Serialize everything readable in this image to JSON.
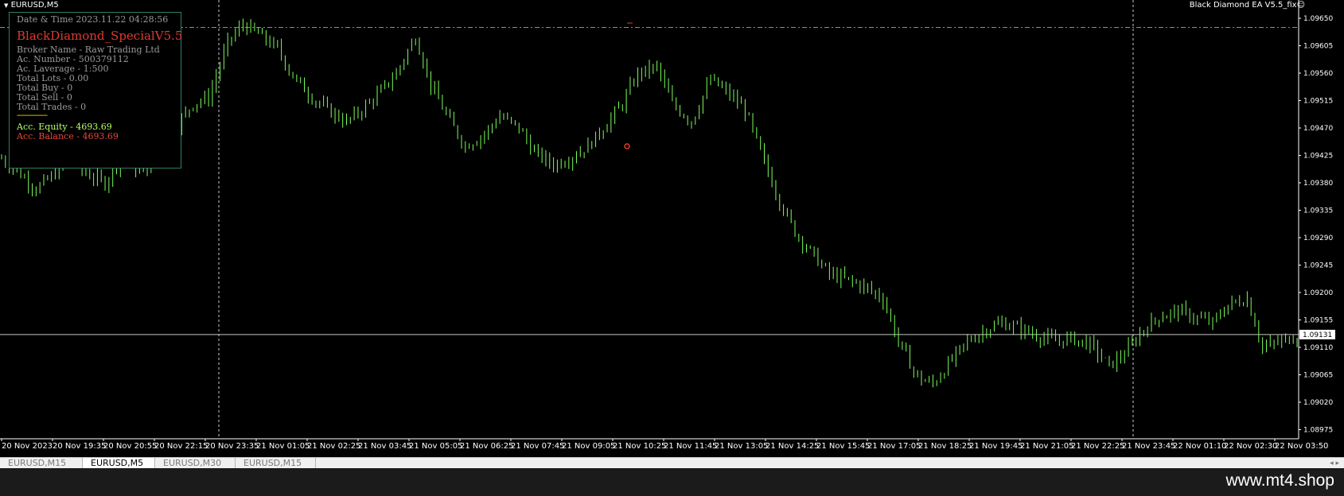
{
  "window": {
    "symbol_label": "EURUSD,M5",
    "ea_label": "Black Diamond EA V5.5_fix☺"
  },
  "info_panel": {
    "datetime": "Date & Time 2023.11.22 04:28:56",
    "title": "BlackDiamond_SpecialV5.5",
    "broker": "Broker Name - Raw Trading Ltd",
    "account_number": "Ac. Number - 500379112",
    "leverage": "Ac. Laverage - 1:500",
    "total_lots": "Total Lots - 0.00",
    "total_buy": "Total Buy - 0",
    "total_sell": "Total Sell - 0",
    "total_trades": "Total Trades - 0",
    "separator": "----------------",
    "equity": "Acc. Equity - 4693.69",
    "balance": "Acc. Balance - 4693.69"
  },
  "colors": {
    "background": "#000000",
    "candle": "#7CFC5B",
    "grid_dashed": "#c8c8c8",
    "dashdot_line": "#7a9a7a",
    "panel_border": "#2f7d67",
    "title_red": "#e03a2f",
    "equity_green": "#b6ff6a",
    "balance_red": "#e24a3b",
    "separator_yellow": "#ffe000"
  },
  "chart_data": {
    "type": "candlestick",
    "symbol": "EURUSD",
    "timeframe": "M5",
    "current_price": "1.09131",
    "dashdot_level": 1.09635,
    "ylim": [
      1.0896,
      1.0968
    ],
    "price_ticks": [
      "1.09650",
      "1.09605",
      "1.09560",
      "1.09515",
      "1.09470",
      "1.09425",
      "1.09380",
      "1.09335",
      "1.09290",
      "1.09245",
      "1.09200",
      "1.09155",
      "1.09110",
      "1.09065",
      "1.09020",
      "1.08975"
    ],
    "time_ticks": [
      "20 Nov 2023",
      "20 Nov 19:35",
      "20 Nov 20:55",
      "20 Nov 22:15",
      "20 Nov 23:35",
      "21 Nov 01:05",
      "21 Nov 02:25",
      "21 Nov 03:45",
      "21 Nov 05:05",
      "21 Nov 06:25",
      "21 Nov 07:45",
      "21 Nov 09:05",
      "21 Nov 10:25",
      "21 Nov 11:45",
      "21 Nov 13:05",
      "21 Nov 14:25",
      "21 Nov 15:45",
      "21 Nov 17:05",
      "21 Nov 18:25",
      "21 Nov 19:45",
      "21 Nov 21:05",
      "21 Nov 22:25",
      "21 Nov 23:45",
      "22 Nov 01:10",
      "22 Nov 02:30",
      "22 Nov 03:50"
    ],
    "close_path": [
      [
        0,
        1.0942
      ],
      [
        4,
        1.094
      ],
      [
        9,
        1.0937
      ],
      [
        13,
        1.0939
      ],
      [
        18,
        1.0942
      ],
      [
        22,
        1.09395
      ],
      [
        27,
        1.0938
      ],
      [
        32,
        1.0943
      ],
      [
        36,
        1.09395
      ],
      [
        41,
        1.0942
      ],
      [
        45,
        1.0947
      ],
      [
        50,
        1.0951
      ],
      [
        54,
        1.0952
      ],
      [
        59,
        1.0961
      ],
      [
        63,
        1.0964
      ],
      [
        68,
        1.0962
      ],
      [
        72,
        1.096
      ],
      [
        76,
        1.09555
      ],
      [
        81,
        1.0952
      ],
      [
        85,
        1.095
      ],
      [
        90,
        1.0948
      ],
      [
        94,
        1.095
      ],
      [
        99,
        1.0953
      ],
      [
        103,
        1.0956
      ],
      [
        108,
        1.0962
      ],
      [
        112,
        1.0954
      ],
      [
        117,
        1.0948
      ],
      [
        121,
        1.0944
      ],
      [
        126,
        1.0946
      ],
      [
        130,
        1.0949
      ],
      [
        135,
        1.0947
      ],
      [
        139,
        1.0943
      ],
      [
        144,
        1.0941
      ],
      [
        148,
        1.0942
      ],
      [
        153,
        1.0944
      ],
      [
        157,
        1.0947
      ],
      [
        162,
        1.0951
      ],
      [
        166,
        1.0956
      ],
      [
        171,
        1.0957
      ],
      [
        175,
        1.0951
      ],
      [
        180,
        1.0948
      ],
      [
        185,
        1.0955
      ],
      [
        189,
        1.0953
      ],
      [
        194,
        1.095
      ],
      [
        198,
        1.0943
      ],
      [
        203,
        1.0935
      ],
      [
        207,
        1.093
      ],
      [
        212,
        1.0926
      ],
      [
        216,
        1.0923
      ],
      [
        221,
        1.0922
      ],
      [
        225,
        1.0921
      ],
      [
        230,
        1.0919
      ],
      [
        234,
        1.0912
      ],
      [
        239,
        1.0906
      ],
      [
        243,
        1.0905
      ],
      [
        248,
        1.0909
      ],
      [
        252,
        1.0912
      ],
      [
        257,
        1.0914
      ],
      [
        261,
        1.0915
      ],
      [
        266,
        1.0914
      ],
      [
        270,
        1.0913
      ],
      [
        275,
        1.0912
      ],
      [
        279,
        1.09125
      ],
      [
        284,
        1.09115
      ],
      [
        289,
        1.0908
      ],
      [
        293,
        1.091
      ],
      [
        298,
        1.0914
      ],
      [
        302,
        1.0916
      ],
      [
        307,
        1.0917
      ],
      [
        311,
        1.0916
      ],
      [
        316,
        1.0915
      ],
      [
        320,
        1.0918
      ],
      [
        325,
        1.0919
      ],
      [
        329,
        1.0911
      ],
      [
        334,
        1.0912
      ],
      [
        338,
        1.0913
      ]
    ]
  },
  "tabs": [
    {
      "label": "EURUSD,M15",
      "active": false
    },
    {
      "label": "EURUSD,M5",
      "active": true
    },
    {
      "label": "EURUSD,M30",
      "active": false
    },
    {
      "label": "EURUSD,M15",
      "active": false
    }
  ],
  "watermark": "www.mt4.shop"
}
